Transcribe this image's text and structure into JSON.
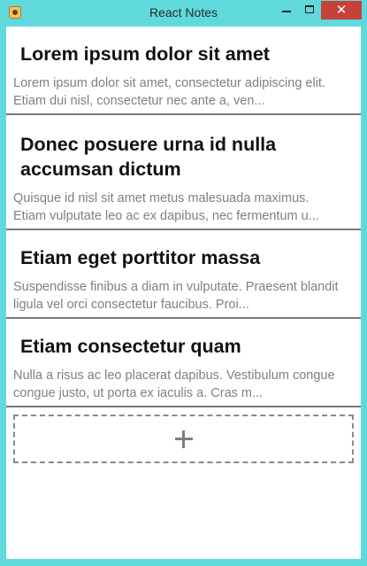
{
  "window": {
    "title": "React Notes",
    "close_symbol": "✕",
    "controls": [
      "minimize-icon",
      "maximize-icon",
      "close-icon"
    ],
    "frame_color": "#5fd9dc",
    "close_color": "#c7403a"
  },
  "notes": [
    {
      "title_lines": [
        "Lorem ipsum dolor sit amet"
      ],
      "body_lines": [
        "Lorem ipsum dolor sit amet, consectetur adipiscing elit.",
        "Etiam dui nisl, consectetur nec ante a, ven..."
      ]
    },
    {
      "title_lines": [
        "Donec posuere urna id nulla",
        "accumsan dictum"
      ],
      "body_lines": [
        "Quisque id nisl sit amet metus malesuada maximus.",
        "Etiam vulputate leo ac ex dapibus, nec fermentum u..."
      ]
    },
    {
      "title_lines": [
        "Etiam eget porttitor massa"
      ],
      "body_lines": [
        "Suspendisse finibus a diam in vulputate. Praesent blandit",
        "ligula vel orci consectetur faucibus. Proi..."
      ]
    },
    {
      "title_lines": [
        "Etiam consectetur quam"
      ],
      "body_lines": [
        "Nulla a risus ac leo placerat dapibus. Vestibulum congue",
        "congue justo, ut porta ex iaculis a. Cras m..."
      ]
    }
  ],
  "add_button": {
    "icon": "plus-icon"
  }
}
